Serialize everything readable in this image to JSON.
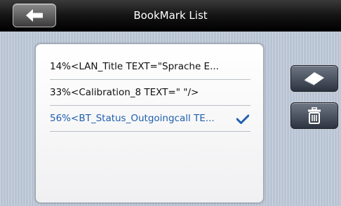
{
  "header": {
    "title": "BookMark List",
    "back_icon": "back-arrow-icon"
  },
  "bookmarks": {
    "items": [
      {
        "label": "14%<LAN_Title TEXT=\"Sprache E..."
      },
      {
        "label": "33%<Calibration_8 TEXT=\" \"/>"
      },
      {
        "label": "56%<BT_Status_Outgoingcall TE...",
        "selected": true
      }
    ],
    "check_icon": "checkmark-icon"
  },
  "actions": {
    "clear_icon": "eraser-icon",
    "delete_icon": "trash-icon"
  },
  "colors": {
    "selected_text": "#1f5fae",
    "titlebar": "#141414"
  }
}
